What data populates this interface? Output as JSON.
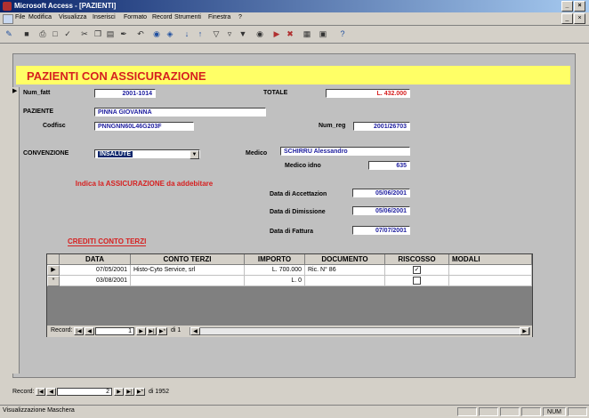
{
  "app": {
    "title": "Microsoft Access - [PAZIENTI]",
    "win_buttons": [
      "_",
      "×"
    ],
    "mdi_buttons": [
      "_",
      "×"
    ]
  },
  "menu": [
    "File",
    "Modifica",
    "Visualizza",
    "Inserisci",
    "Formato",
    "Record",
    "Strumenti",
    "Finestra",
    "?"
  ],
  "toolbar_icons": [
    "design-view-icon",
    "save-icon",
    "print-icon",
    "print-preview-icon",
    "spelling-icon",
    "cut-icon",
    "copy-icon",
    "paste-icon",
    "format-painter-icon",
    "undo-icon",
    "hyperlink-icon",
    "web-toolbar-icon",
    "sort-ascending-icon",
    "sort-descending-icon",
    "filter-by-selection-icon",
    "filter-by-form-icon",
    "apply-filter-icon",
    "find-icon",
    "new-record-icon",
    "delete-record-icon",
    "database-window-icon",
    "new-object-icon",
    "help-icon"
  ],
  "form": {
    "header_title": "PAZIENTI CON ASSICURAZIONE",
    "num_fatt_label": "Num_fatt",
    "num_fatt_value": "2001-1014",
    "totale_label": "TOTALE",
    "totale_value": "L. 432.000",
    "paziente_label": "PAZIENTE",
    "paziente_value": "PINNA GIOVANNA",
    "num_reg_label": "Num_reg",
    "num_reg_value": "2001/26703",
    "codfisc_label": "Codfisc",
    "codfisc_value": "PNNGNN60L46G203F",
    "convenzione_label": "CONVENZIONE",
    "convenzione_value": "INSALUTE",
    "medico_label": "Medico",
    "medico_value": "SCHIRRU Alessandro",
    "medico_idno_label": "Medico idno",
    "medico_idno_value": "635",
    "indica_text": "Indica la ASSICURAZIONE da addebitare",
    "data_accettazione_label": "Data di Accettazion",
    "data_accettazione_value": "05/06/2001",
    "data_dimissione_label": "Data di Dimissione",
    "data_dimissione_value": "05/06/2001",
    "data_fattura_label": "Data di Fattura",
    "data_fattura_value": "07/07/2001",
    "crediti_title": "CREDITI CONTO TERZI"
  },
  "subform": {
    "columns": [
      "DATA",
      "CONTO TERZI",
      "IMPORTO",
      "DOCUMENTO",
      "RISCOSSO",
      "MODALI"
    ],
    "rows": [
      {
        "selector": "▶",
        "data": "07/05/2001",
        "conto_terzi": "Histo-Cyto Service, srl",
        "importo": "L. 700.000",
        "documento": "Ric. N° 86",
        "riscosso": true
      },
      {
        "selector": "*",
        "data": "03/08/2001",
        "conto_terzi": "",
        "importo": "L. 0",
        "documento": "",
        "riscosso": false
      }
    ],
    "nav": {
      "label": "Record:",
      "current": "1",
      "of_text": "di 1"
    }
  },
  "main_nav": {
    "label": "Record:",
    "current": "2",
    "of_text": "di 1952"
  },
  "status": {
    "text": "Visualizzazione Maschera",
    "num": "NUM"
  }
}
